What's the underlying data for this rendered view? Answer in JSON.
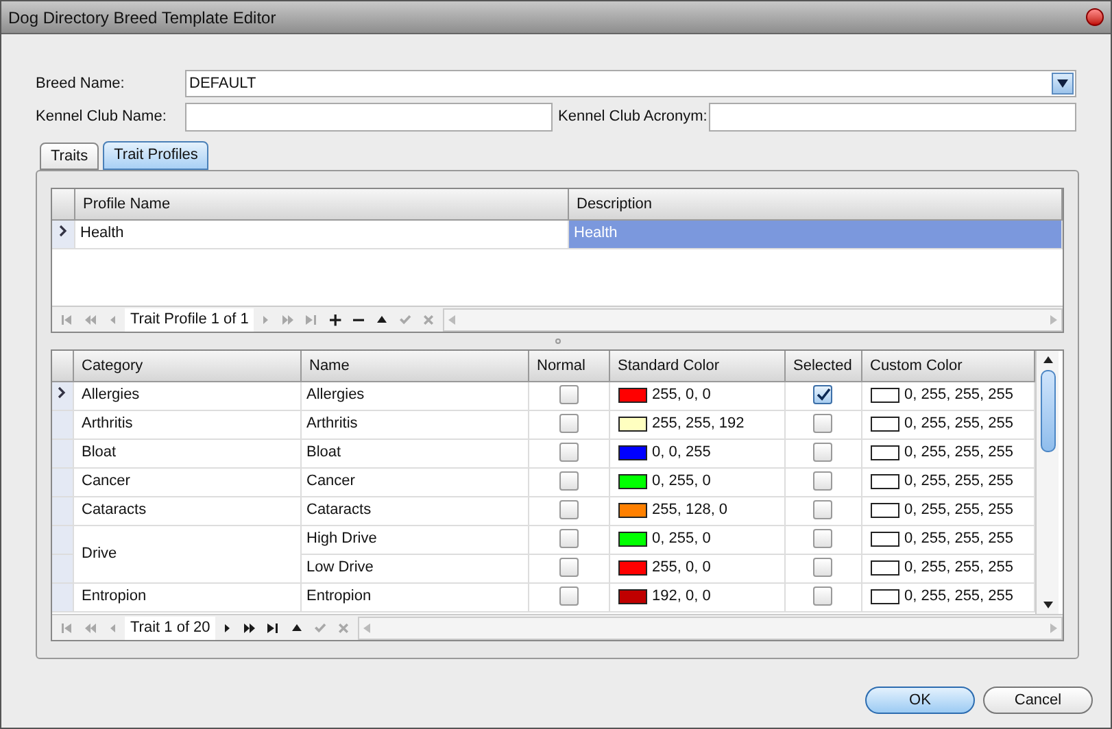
{
  "window": {
    "title": "Dog Directory Breed Template Editor"
  },
  "form": {
    "breed_name": {
      "label": "Breed Name:",
      "value": "DEFAULT"
    },
    "kennel_club_name": {
      "label": "Kennel Club Name:"
    },
    "kennel_club_acronym": {
      "label": "Kennel Club Acronym:"
    }
  },
  "tabs": [
    {
      "label": "Traits",
      "selected": false
    },
    {
      "label": "Trait Profiles",
      "selected": true
    }
  ],
  "profiles": {
    "columns": [
      "Profile Name",
      "Description"
    ],
    "rows": [
      {
        "current": true,
        "cells": [
          {
            "text": "Health",
            "selected": false
          },
          {
            "text": "Health",
            "selected": true
          }
        ]
      }
    ],
    "navigator": {
      "text": "Trait Profile 1 of 1",
      "buttons": [
        {
          "kind": "first",
          "enabled": false
        },
        {
          "kind": "prev_page",
          "enabled": false
        },
        {
          "kind": "prev",
          "enabled": false
        },
        {
          "kind": "next",
          "enabled": false
        },
        {
          "kind": "next_page",
          "enabled": false
        },
        {
          "kind": "last",
          "enabled": false
        },
        {
          "kind": "add",
          "enabled": true
        },
        {
          "kind": "remove",
          "enabled": true
        },
        {
          "kind": "up",
          "enabled": true
        },
        {
          "kind": "check",
          "enabled": false
        },
        {
          "kind": "cancel",
          "enabled": false
        }
      ]
    }
  },
  "traits": {
    "columns": [
      "Category",
      "Name",
      "Normal",
      "Standard Color",
      "Selected",
      "Custom Color"
    ],
    "groups": [
      {
        "category": "Allergies",
        "items": [
          {
            "current": true,
            "name": "Allergies",
            "normal": false,
            "standard": {
              "color": "#ff0000",
              "label": "255, 0, 0"
            },
            "selected": true,
            "custom": {
              "color": "#ffffff",
              "label": "0, 255, 255, 255"
            }
          }
        ]
      },
      {
        "category": "Arthritis",
        "items": [
          {
            "current": false,
            "name": "Arthritis",
            "normal": false,
            "standard": {
              "color": "#ffffc0",
              "label": "255, 255, 192"
            },
            "selected": false,
            "custom": {
              "color": "#ffffff",
              "label": "0, 255, 255, 255"
            }
          }
        ]
      },
      {
        "category": "Bloat",
        "items": [
          {
            "current": false,
            "name": "Bloat",
            "normal": false,
            "standard": {
              "color": "#0000ff",
              "label": "0, 0, 255"
            },
            "selected": false,
            "custom": {
              "color": "#ffffff",
              "label": "0, 255, 255, 255"
            }
          }
        ]
      },
      {
        "category": "Cancer",
        "items": [
          {
            "current": false,
            "name": "Cancer",
            "normal": false,
            "standard": {
              "color": "#00ff00",
              "label": "0, 255, 0"
            },
            "selected": false,
            "custom": {
              "color": "#ffffff",
              "label": "0, 255, 255, 255"
            }
          }
        ]
      },
      {
        "category": "Cataracts",
        "items": [
          {
            "current": false,
            "name": "Cataracts",
            "normal": false,
            "standard": {
              "color": "#ff8000",
              "label": "255, 128, 0"
            },
            "selected": false,
            "custom": {
              "color": "#ffffff",
              "label": "0, 255, 255, 255"
            }
          }
        ]
      },
      {
        "category": "Drive",
        "items": [
          {
            "current": false,
            "name": "High Drive",
            "normal": false,
            "standard": {
              "color": "#00ff00",
              "label": "0, 255, 0"
            },
            "selected": false,
            "custom": {
              "color": "#ffffff",
              "label": "0, 255, 255, 255"
            }
          },
          {
            "current": false,
            "name": "Low Drive",
            "normal": false,
            "standard": {
              "color": "#ff0000",
              "label": "255, 0, 0"
            },
            "selected": false,
            "custom": {
              "color": "#ffffff",
              "label": "0, 255, 255, 255"
            }
          }
        ]
      },
      {
        "category": "Entropion",
        "items": [
          {
            "current": false,
            "name": "Entropion",
            "normal": false,
            "standard": {
              "color": "#c00000",
              "label": "192, 0, 0"
            },
            "selected": false,
            "custom": {
              "color": "#ffffff",
              "label": "0, 255, 255, 255"
            }
          }
        ]
      }
    ],
    "navigator": {
      "text": "Trait 1 of 20",
      "buttons": [
        {
          "kind": "first",
          "enabled": false
        },
        {
          "kind": "prev_page",
          "enabled": false
        },
        {
          "kind": "prev",
          "enabled": false
        },
        {
          "kind": "next",
          "enabled": true
        },
        {
          "kind": "next_page",
          "enabled": true
        },
        {
          "kind": "last",
          "enabled": true
        },
        {
          "kind": "up",
          "enabled": true
        },
        {
          "kind": "check",
          "enabled": false
        },
        {
          "kind": "cancel",
          "enabled": false
        }
      ]
    }
  },
  "buttons": [
    {
      "label": "OK",
      "default": true
    },
    {
      "label": "Cancel",
      "default": false
    }
  ]
}
